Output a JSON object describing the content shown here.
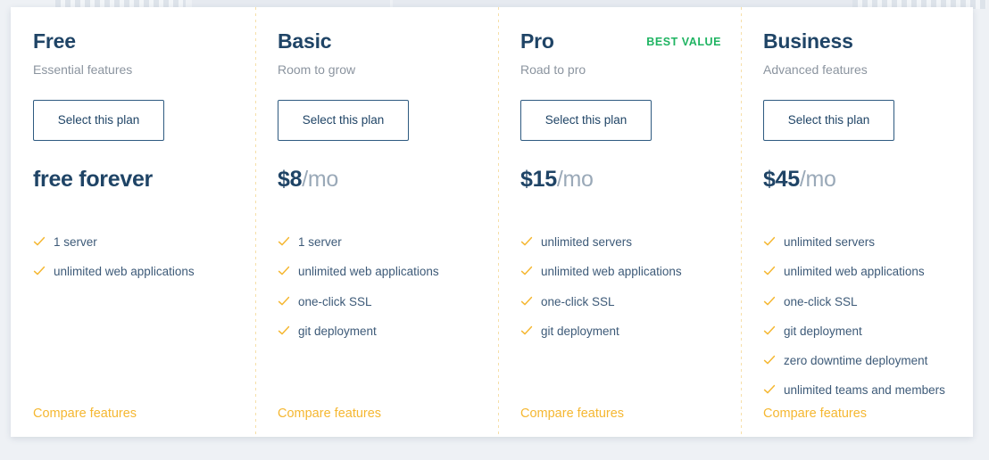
{
  "colors": {
    "heading": "#1f4466",
    "tagline": "#8b949f",
    "best_value": "#1fb462",
    "check": "#f5b731",
    "compare_link": "#f5b731",
    "button_border": "#2e5a80",
    "price_suffix": "#9aa9b8",
    "divider": "#f6dfa8",
    "page_background": "#eef1f5",
    "card_background": "#ffffff"
  },
  "icons": {
    "check": "check-icon"
  },
  "plans": [
    {
      "name": "Free",
      "tagline": "Essential features",
      "badge": "",
      "button_label": "Select this plan",
      "price_main": "free forever",
      "price_suffix": "",
      "features": [
        "1 server",
        "unlimited web applications"
      ],
      "compare_label": "Compare features"
    },
    {
      "name": "Basic",
      "tagline": "Room to grow",
      "badge": "",
      "button_label": "Select this plan",
      "price_main": "$8",
      "price_suffix": "/mo",
      "features": [
        "1 server",
        "unlimited web applications",
        "one-click SSL",
        "git deployment"
      ],
      "compare_label": "Compare features"
    },
    {
      "name": "Pro",
      "tagline": "Road to pro",
      "badge": "BEST VALUE",
      "button_label": "Select this plan",
      "price_main": "$15",
      "price_suffix": "/mo",
      "features": [
        "unlimited servers",
        "unlimited web applications",
        "one-click SSL",
        "git deployment"
      ],
      "compare_label": "Compare features"
    },
    {
      "name": "Business",
      "tagline": "Advanced features",
      "badge": "",
      "button_label": "Select this plan",
      "price_main": "$45",
      "price_suffix": "/mo",
      "features": [
        "unlimited servers",
        "unlimited web applications",
        "one-click SSL",
        "git deployment",
        "zero downtime deployment",
        "unlimited teams and members"
      ],
      "compare_label": "Compare features"
    }
  ]
}
